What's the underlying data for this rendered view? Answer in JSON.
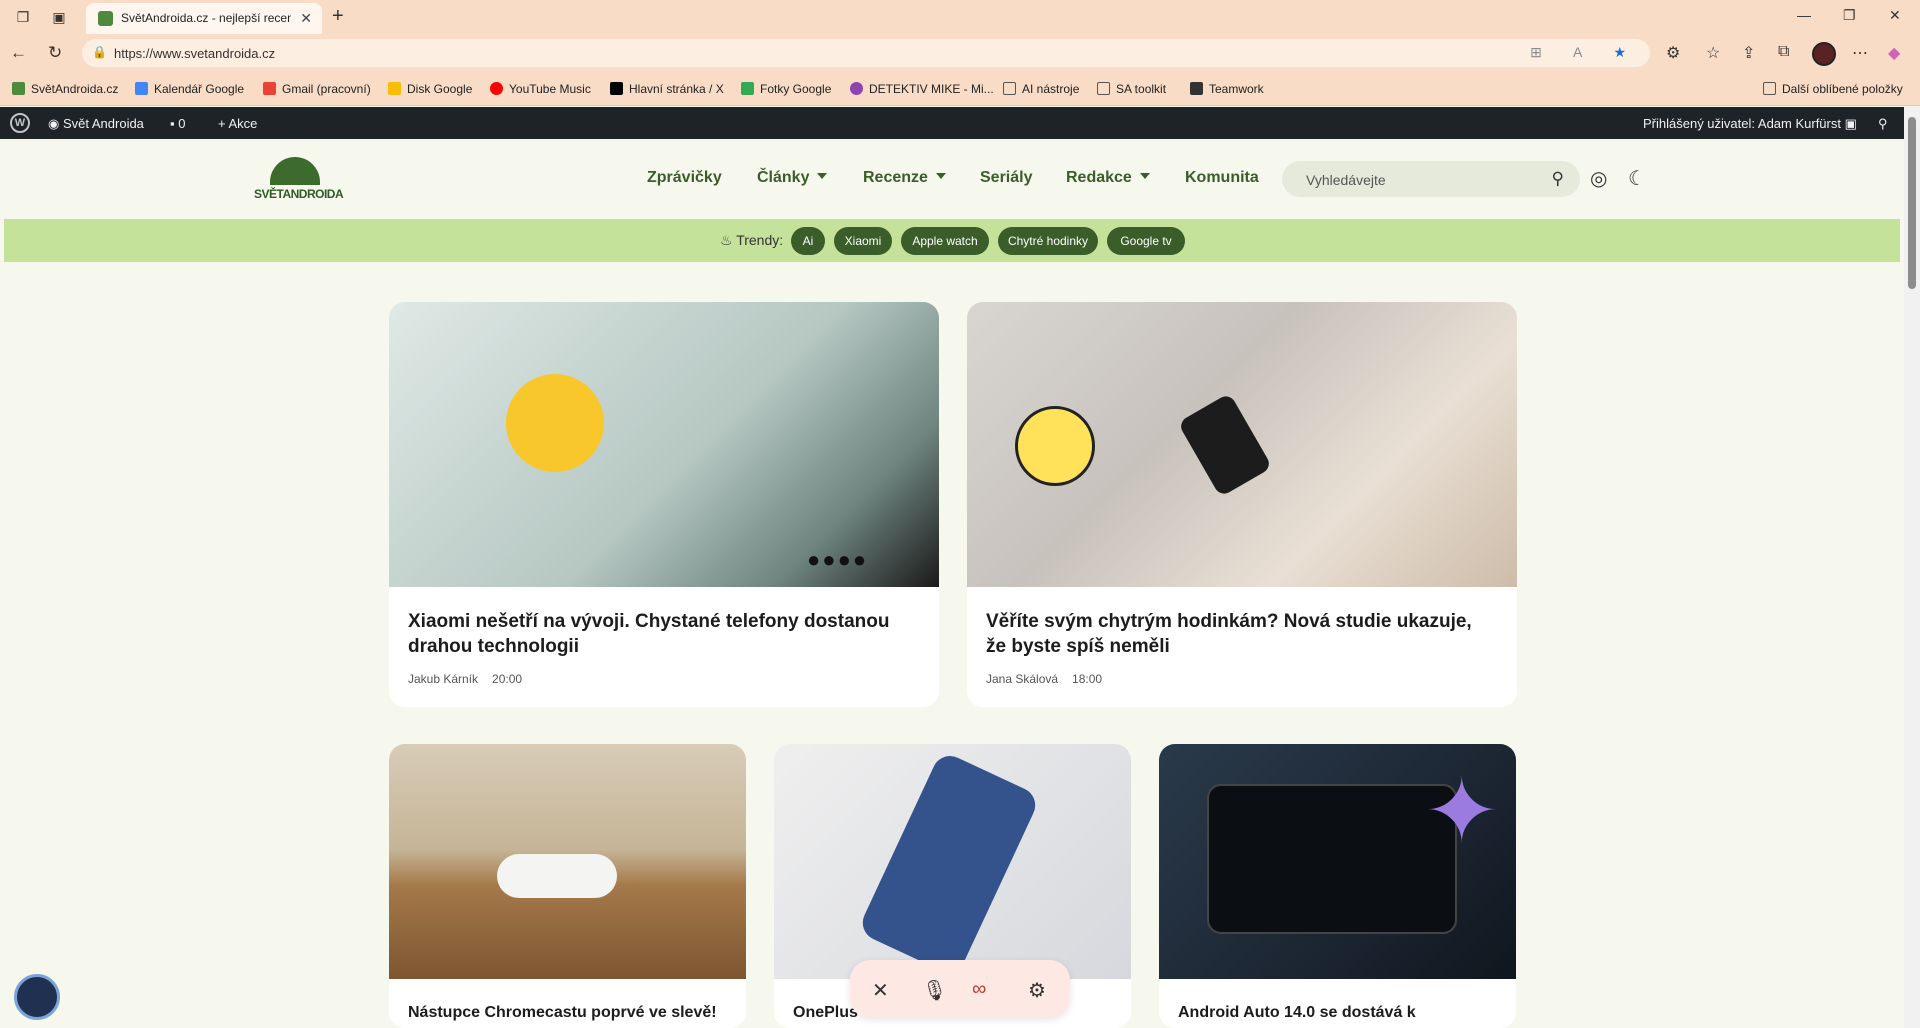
{
  "browser": {
    "tab_title": "SvětAndroida.cz - nejlepší recenze",
    "url": "https://www.svetandroida.cz",
    "bookmarks": [
      "SvětAndroida.cz",
      "Kalendář Google",
      "Gmail (pracovní)",
      "Disk Google",
      "YouTube Music",
      "Hlavní stránka / X",
      "Fotky Google",
      "DETEKTIV MIKE - Mi...",
      "AI nástroje",
      "SA toolkit",
      "Teamwork"
    ],
    "other_bookmarks": "Další oblíbené položky"
  },
  "wpbar": {
    "site": "Svět Androida",
    "comments": "0",
    "new": "Akce",
    "user": "Přihlášený uživatel: Adam Kurfürst"
  },
  "site": {
    "logo": "SVĚTANDROIDA",
    "menu": [
      "Zprávičky",
      "Články",
      "Recenze",
      "Seriály",
      "Redakce",
      "Komunita"
    ],
    "search_placeholder": "Vyhledávejte"
  },
  "trends": {
    "label": "Trendy:",
    "chips": [
      "Ai",
      "Xiaomi",
      "Apple watch",
      "Chytré hodinky",
      "Google tv"
    ]
  },
  "articles": [
    {
      "title": "Xiaomi nešetří na vývoji. Chystané telefony dostanou drahou technologii",
      "author": "Jakub Kárník",
      "time": "20:00"
    },
    {
      "title": "Věříte svým chytrým hodinkám? Nová studie ukazuje, že byste spíš neměli",
      "author": "Jana Skálová",
      "time": "18:00"
    },
    {
      "title": "Nástupce Chromecastu poprvé ve slevě!"
    },
    {
      "title": "OnePlus"
    },
    {
      "title": "Android Auto 14.0 se dostává k"
    }
  ],
  "colors": {
    "accent": "#3b5d2a",
    "trend_bar": "#c4e29a",
    "chrome": "#f9dcc6"
  }
}
